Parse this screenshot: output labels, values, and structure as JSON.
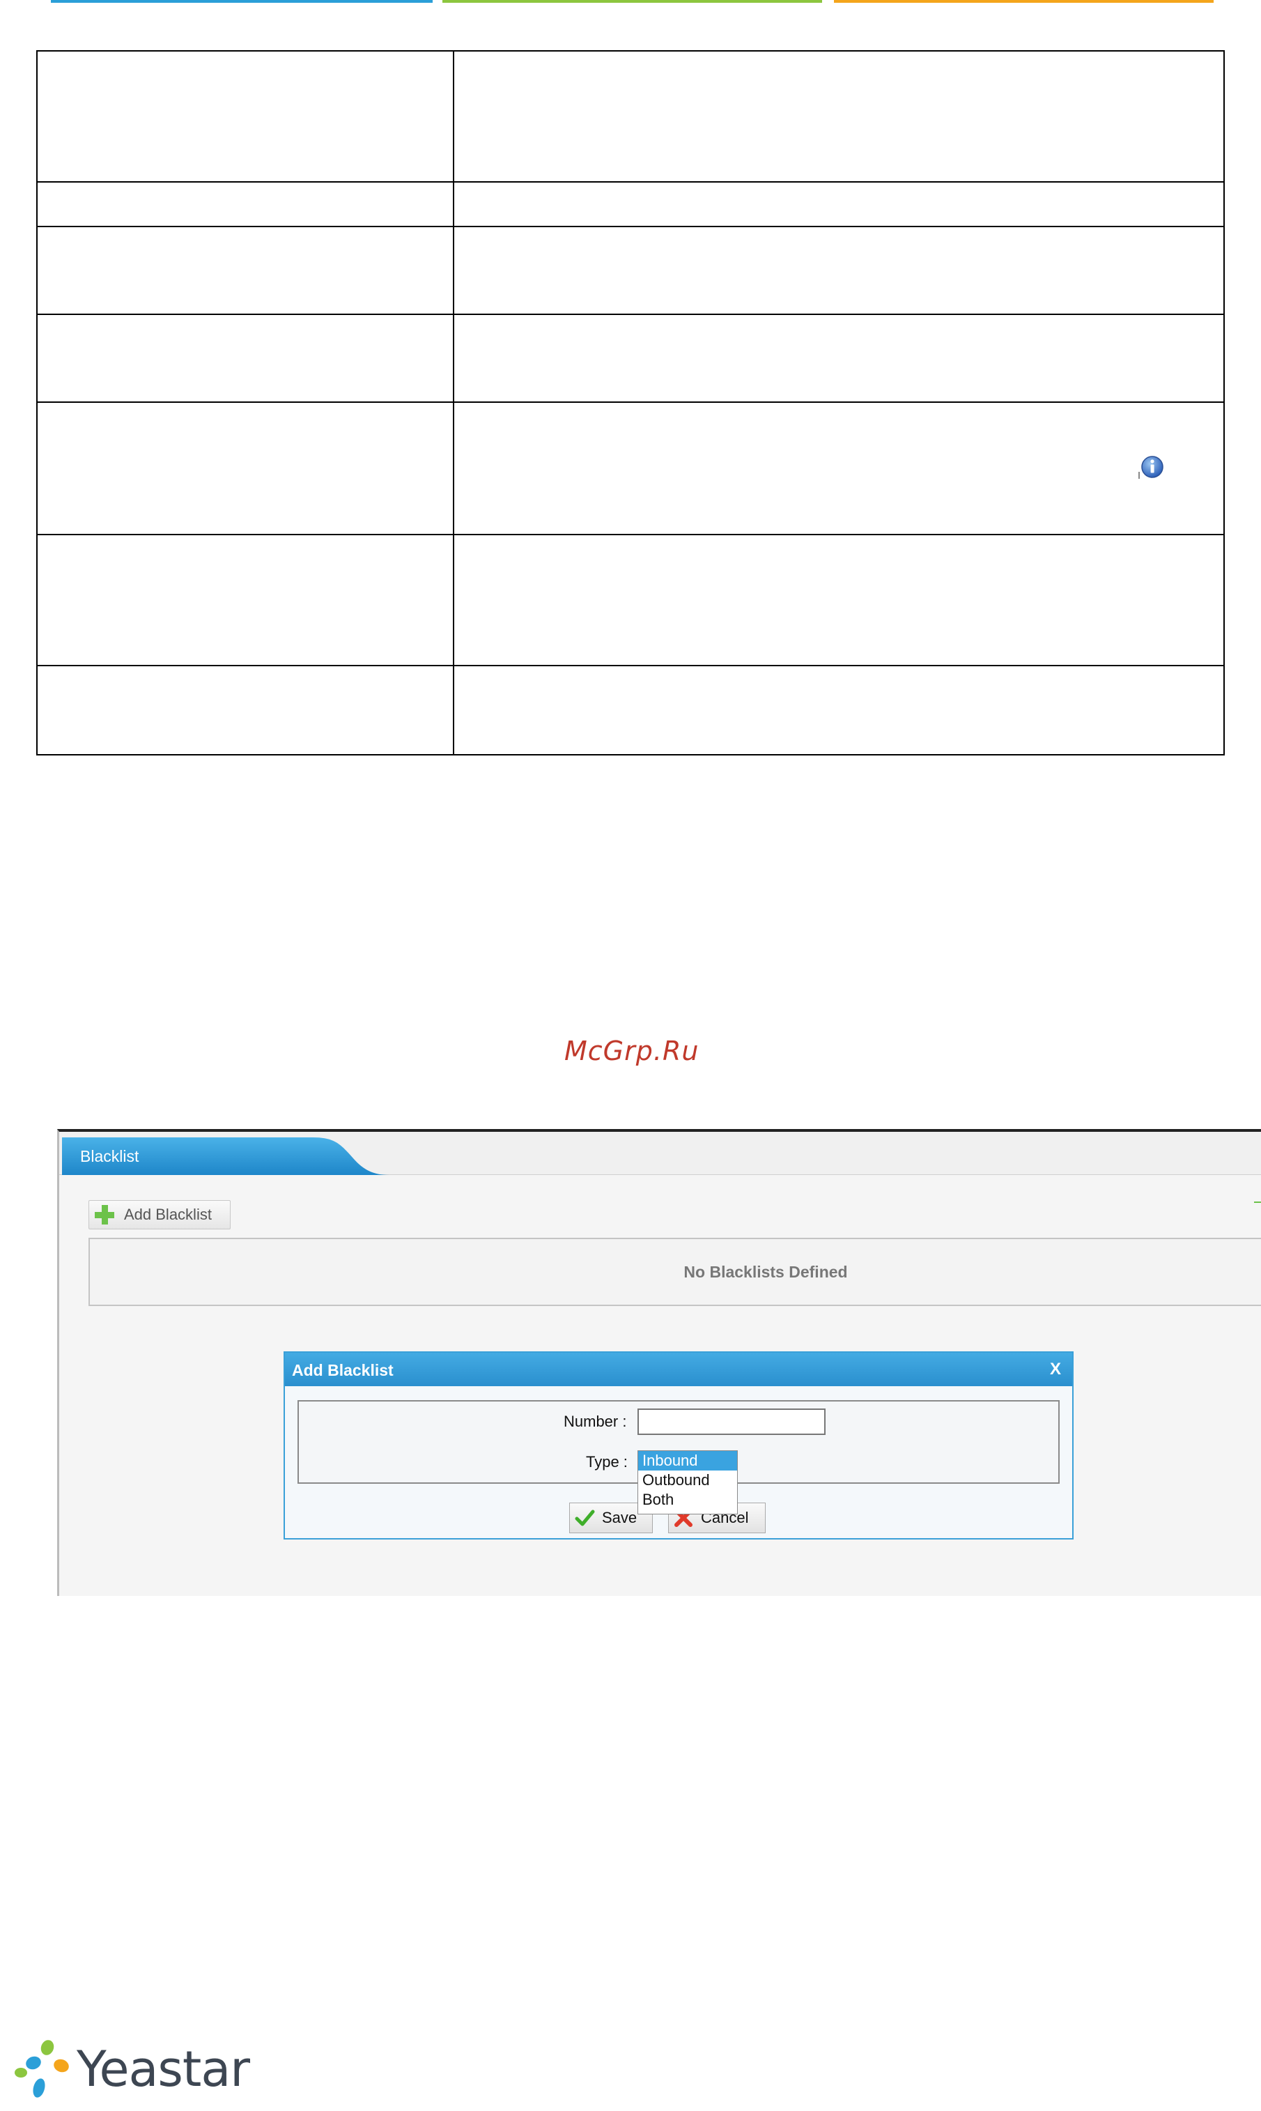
{
  "watermark": "McGrp.Ru",
  "panel": {
    "tab_label": "Blacklist",
    "add_button": "Add Blacklist",
    "empty_message": "No Blacklists Defined"
  },
  "dialog": {
    "title": "Add Blacklist",
    "close": "X",
    "number_label": "Number :",
    "number_value": "",
    "type_label": "Type :",
    "type_options": [
      "Inbound",
      "Outbound",
      "Both"
    ],
    "type_selected": "Inbound",
    "save_label": "Save",
    "cancel_label": "Cancel"
  },
  "logo": {
    "text": "Yeastar"
  },
  "colors": {
    "accent_blue": "#2b9fd8",
    "accent_green": "#8cc63f",
    "accent_orange": "#f4a51c"
  }
}
